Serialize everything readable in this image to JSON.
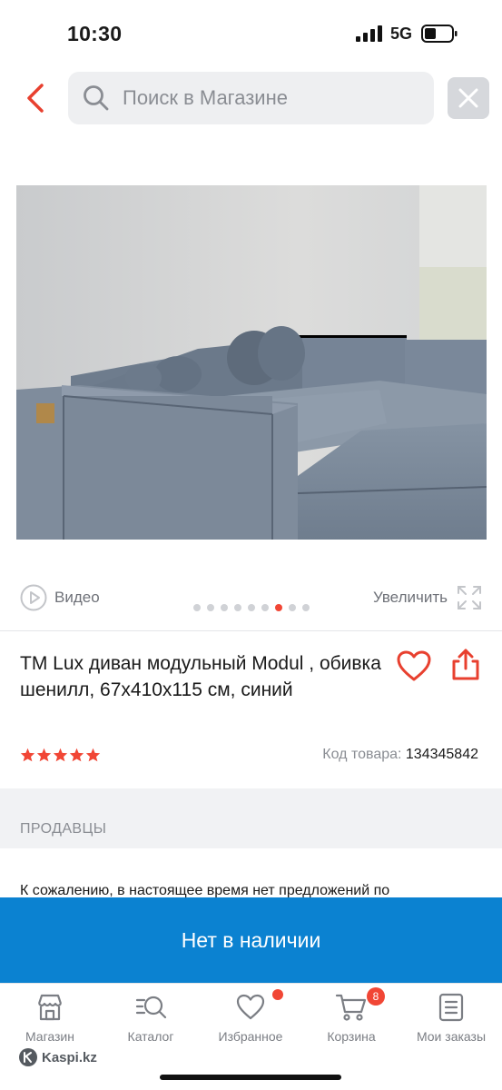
{
  "status_bar": {
    "time": "10:30",
    "network": "5G"
  },
  "search": {
    "placeholder": "Поиск в Магазине"
  },
  "gallery": {
    "video_label": "Видео",
    "zoom_label": "Увеличить",
    "dot_count": 9,
    "active_dot": 6
  },
  "product": {
    "title": "ТМ Lux диван модульный Modul , обивка шенилл, 67х410х115 см, синий",
    "rating_stars": 5,
    "code_label": "Код товара:",
    "code_value": "134345842"
  },
  "sellers": {
    "title": "ПРОДАВЦЫ",
    "no_offers_text": "К сожалению, в настоящее время нет предложений по"
  },
  "cta": {
    "label": "Нет в наличии"
  },
  "tabbar": {
    "items": [
      {
        "label": "Магазин",
        "icon": "store-icon"
      },
      {
        "label": "Каталог",
        "icon": "catalog-search-icon"
      },
      {
        "label": "Избранное",
        "icon": "heart-icon"
      },
      {
        "label": "Корзина",
        "icon": "cart-icon",
        "badge": "8"
      },
      {
        "label": "Мои заказы",
        "icon": "orders-icon"
      }
    ]
  },
  "brand": {
    "logo_text": "Kaspi.kz"
  },
  "colors": {
    "accent_red": "#f14635",
    "cta_blue": "#0b82d1",
    "muted_gray": "#8a8d93"
  }
}
